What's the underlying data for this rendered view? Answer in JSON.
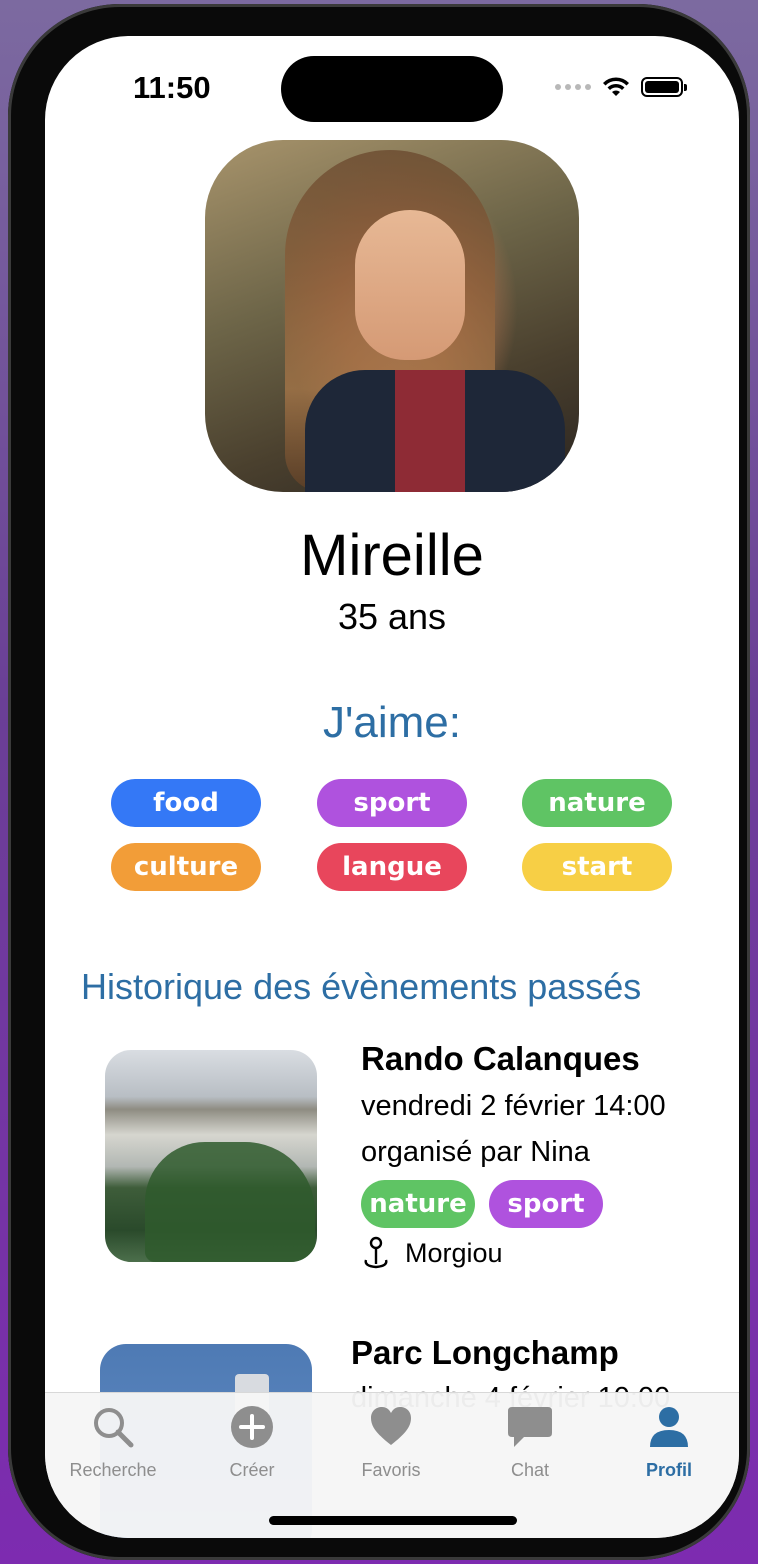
{
  "status_bar": {
    "time": "11:50"
  },
  "profile": {
    "name": "Mireille",
    "age": "35 ans"
  },
  "likes": {
    "title": "J'aime:",
    "tags": [
      {
        "label": "food",
        "color": "#3478f6"
      },
      {
        "label": "sport",
        "color": "#af52de"
      },
      {
        "label": "nature",
        "color": "#5fc464"
      },
      {
        "label": "culture",
        "color": "#f29d38"
      },
      {
        "label": "langue",
        "color": "#e8465c"
      },
      {
        "label": "start",
        "color": "#f7cf45"
      }
    ]
  },
  "history": {
    "title": "Historique des évènements passés",
    "events": [
      {
        "title": "Rando Calanques",
        "date": "vendredi 2 février 14:00",
        "organizer": "organisé par Nina",
        "tags": [
          "nature",
          "sport"
        ],
        "location": "Morgiou"
      },
      {
        "title": "Parc Longchamp",
        "date": "dimanche 4 février 10:00"
      }
    ]
  },
  "tabbar": {
    "tabs": [
      {
        "label": "Recherche",
        "icon": "magnifier-icon"
      },
      {
        "label": "Créer",
        "icon": "plus-circle-icon"
      },
      {
        "label": "Favoris",
        "icon": "heart-icon"
      },
      {
        "label": "Chat",
        "icon": "chat-bubble-icon"
      },
      {
        "label": "Profil",
        "icon": "person-icon"
      }
    ],
    "active": "Profil"
  }
}
